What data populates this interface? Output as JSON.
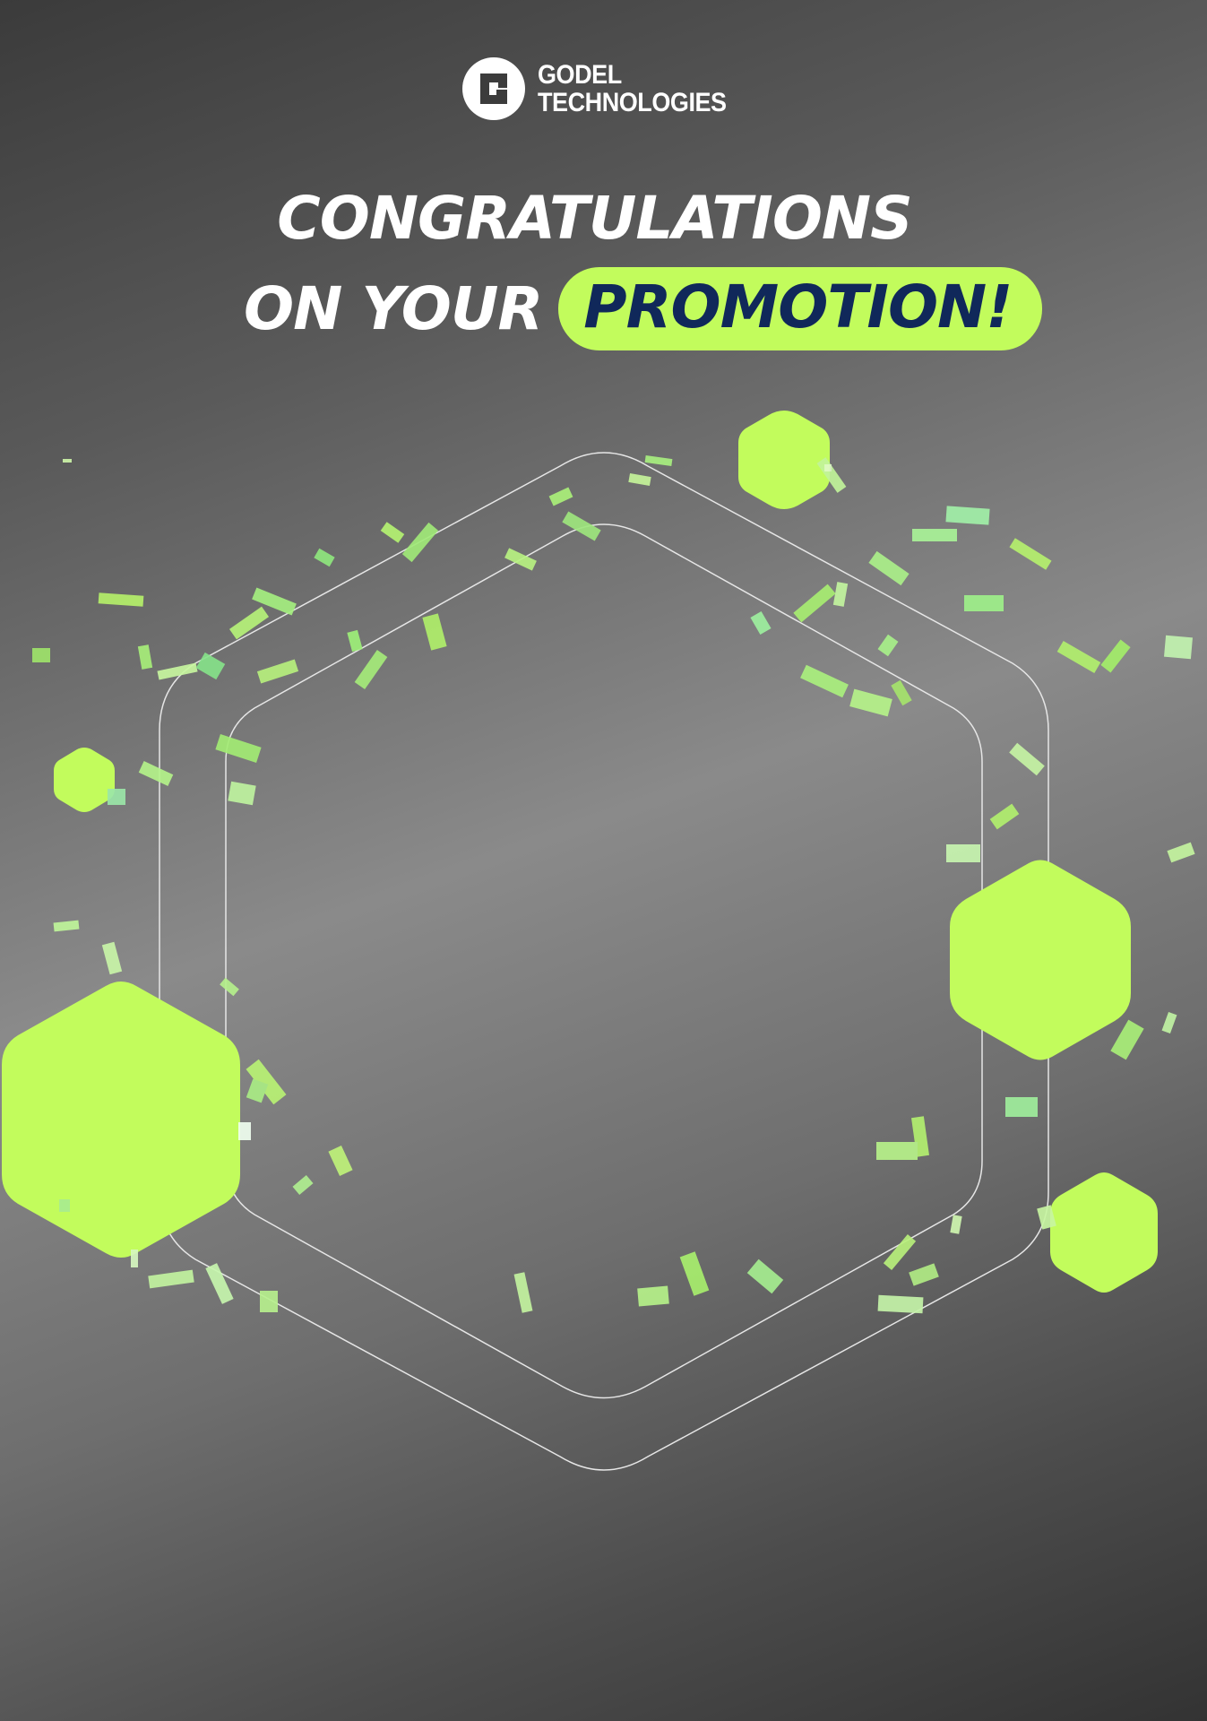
{
  "brand": {
    "name_line1": "GODEL",
    "name_line2": "TECHNOLOGIES"
  },
  "headline": {
    "line1": "CONGRATULATIONS",
    "line2_prefix": "ON YOUR",
    "line2_highlight": "PROMOTION!"
  },
  "colors": {
    "accent": "#c2fc5c",
    "highlight_text": "#10285a",
    "text": "#ffffff",
    "outline": "#d9d9d9"
  },
  "icons": {
    "logo": "godel-g-logo-icon"
  }
}
